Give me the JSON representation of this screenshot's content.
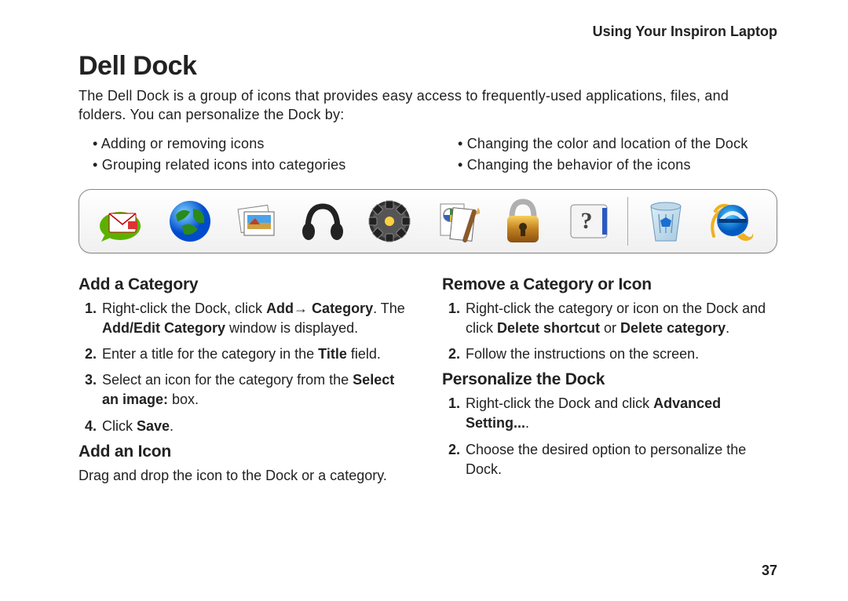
{
  "header": "Using Your Inspiron Laptop",
  "title": "Dell Dock",
  "intro": "The Dell Dock is a group of icons that provides easy access to frequently-used applications, files, and folders. You can personalize the Dock by:",
  "bullets_left": [
    "Adding or removing icons",
    "Grouping related icons into categories"
  ],
  "bullets_right": [
    "Changing the color and location of the Dock",
    "Changing the behavior of the icons"
  ],
  "dock_icons": [
    "mail",
    "globe",
    "pictures",
    "headphones",
    "media",
    "documents",
    "security",
    "help",
    "sep",
    "recycle-bin",
    "internet-explorer"
  ],
  "left_col": {
    "section1": {
      "heading": "Add a Category",
      "steps": [
        "Right-click the Dock, click <b>Add→ Category</b>. The <b>Add/Edit Category</b> window is displayed.",
        "Enter a title for the category in the <b>Title</b> field.",
        "Select an icon for the category from the <b>Select an image:</b> box.",
        "Click <b>Save</b>."
      ]
    },
    "section2": {
      "heading": "Add an Icon",
      "text": "Drag and drop the icon to the Dock or a category."
    }
  },
  "right_col": {
    "section1": {
      "heading": "Remove a Category or Icon",
      "steps": [
        "Right-click the category or icon on the Dock and click <b>Delete shortcut</b> or <b>Delete category</b>.",
        "Follow the instructions on the screen."
      ]
    },
    "section2": {
      "heading": "Personalize the Dock",
      "steps": [
        "Right-click the Dock and click <b>Advanced Setting...</b>.",
        "Choose the desired option to personalize the Dock."
      ]
    }
  },
  "page_number": "37"
}
